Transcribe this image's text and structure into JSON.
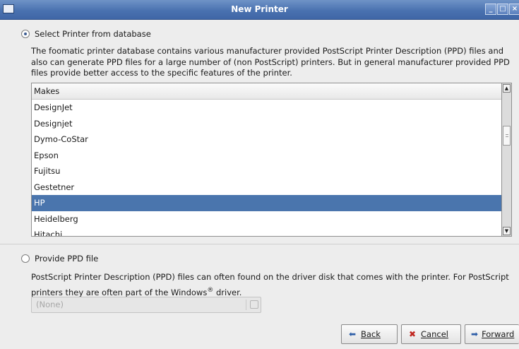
{
  "window": {
    "title": "New Printer",
    "controls": [
      "minimize",
      "maximize",
      "close"
    ]
  },
  "database_option": {
    "label": "Select Printer from database",
    "selected": true,
    "description_lines": [
      "The foomatic printer database contains various manufacturer provided PostScript Printer Description (PPD) files and",
      "also can generate PPD files for a large number of (non PostScript) printers. But in general manufacturer provided PPD",
      "files provide better access to the specific features of the printer."
    ]
  },
  "makes_list": {
    "header": "Makes",
    "items": [
      "DesignJet",
      "Designjet",
      "Dymo-CoStar",
      "Epson",
      "Fujitsu",
      "Gestetner",
      "HP",
      "Heidelberg",
      "Hitachi"
    ],
    "selected": "HP"
  },
  "ppd_option": {
    "label": "Provide PPD file",
    "selected": false,
    "description_line1": "PostScript Printer Description (PPD) files can often found on the driver disk that comes with the printer. For PostScript",
    "description_line2_pre": "printers they are often part of the Windows",
    "description_line2_sup": "®",
    "description_line2_post": " driver.",
    "file_value": "(None)"
  },
  "buttons": {
    "back": "Back",
    "cancel": "Cancel",
    "forward": "Forward"
  },
  "colors": {
    "selection": "#4a75ad",
    "titlebar": "#4a72b0"
  }
}
